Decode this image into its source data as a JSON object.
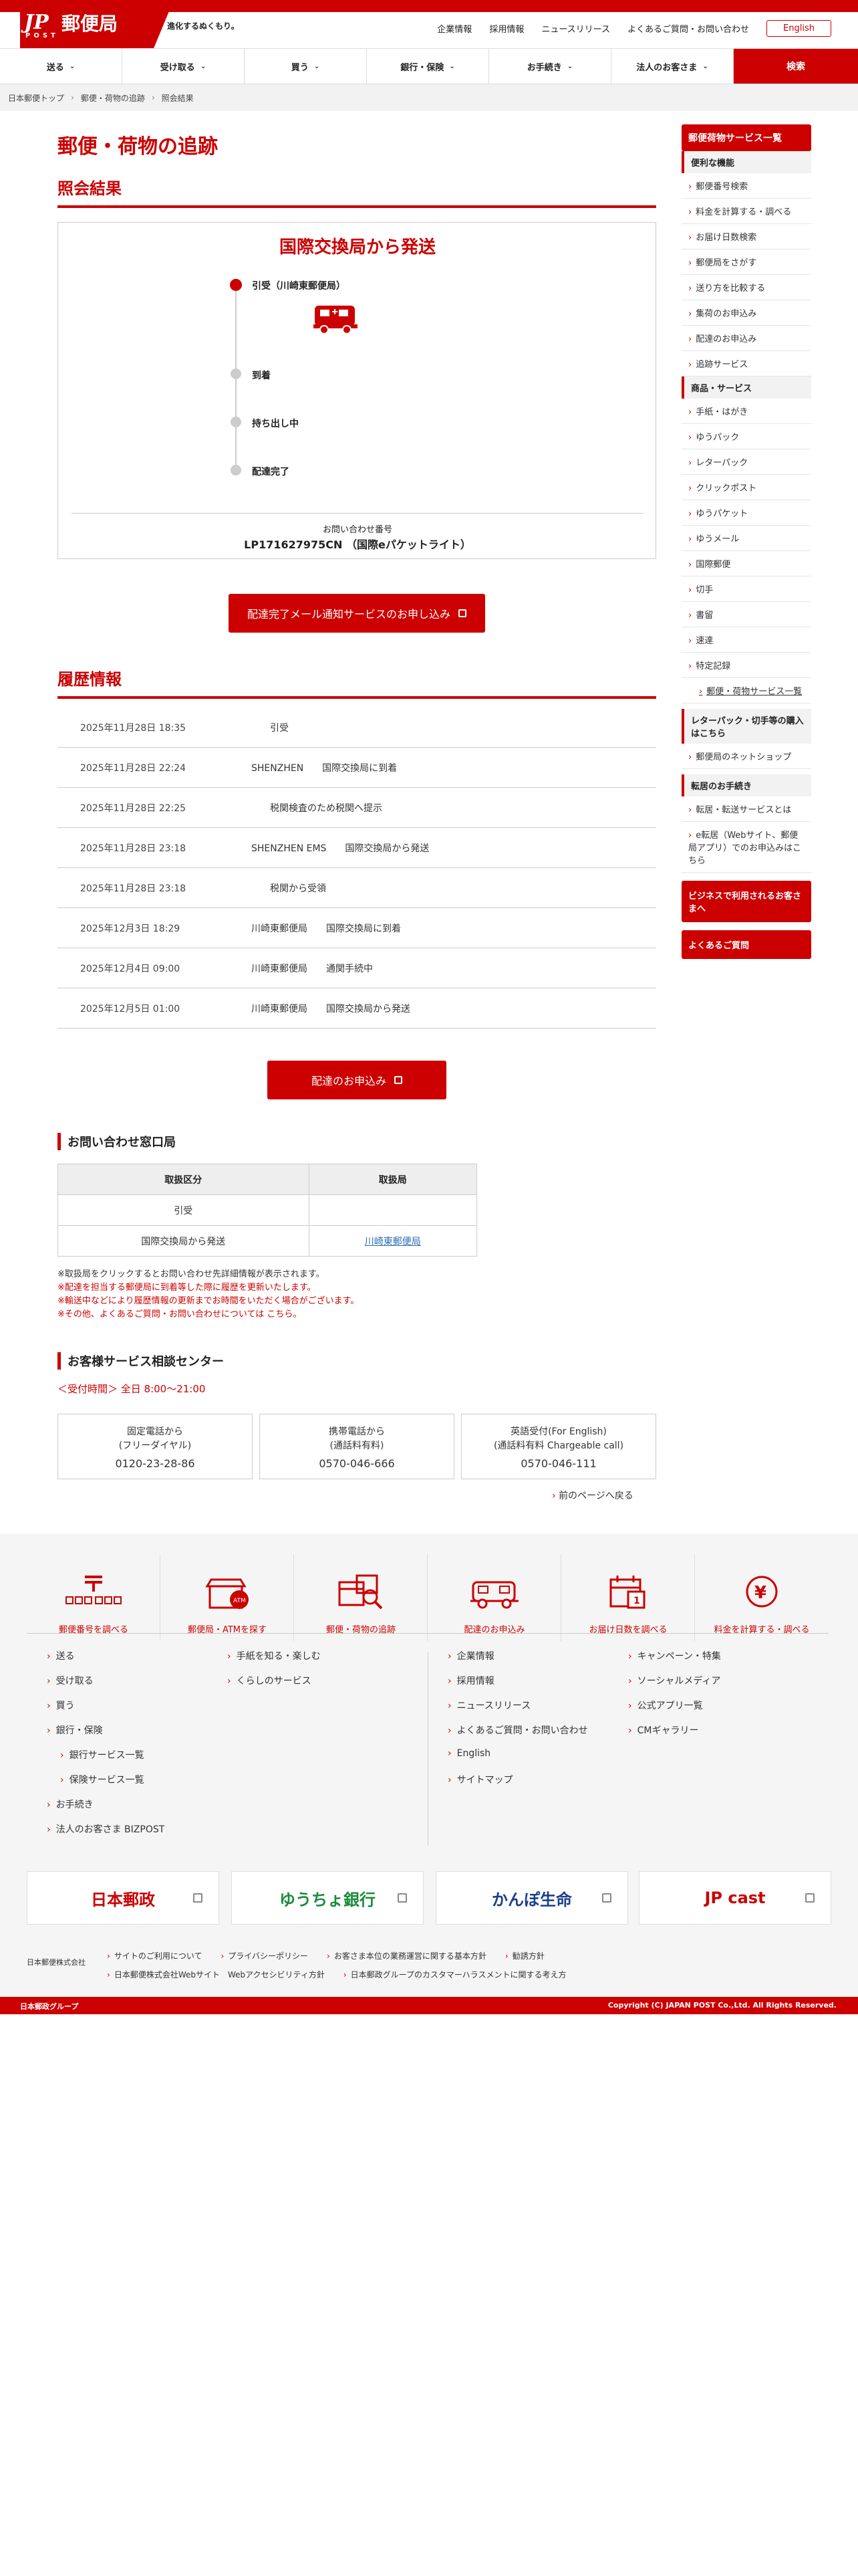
{
  "brand": {
    "logo_text": "JP",
    "logo_sub": "POST",
    "name": "郵便局",
    "tagline": "進化するぬくもり。",
    "accent": "#cc0000"
  },
  "util": [
    "企業情報",
    "採用情報",
    "ニュースリリース",
    "よくあるご質問・お問い合わせ"
  ],
  "util_english": "English",
  "nav": [
    "送る",
    "受け取る",
    "買う",
    "銀行・保険",
    "お手続き",
    "法人のお客さま"
  ],
  "nav_search": "検索",
  "breadcrumb": [
    "日本郵便トップ",
    "郵便・荷物の追跡",
    "照会結果"
  ],
  "page_title": "郵便・荷物の追跡",
  "result": {
    "heading": "照会結果",
    "status": "国際交換局から発送",
    "steps": [
      "引受（川崎東郵便局）",
      "到着",
      "持ち出し中",
      "配達完了"
    ],
    "inquiry_label": "お問い合わせ番号",
    "inquiry_number": "LP171627975CN （国際eパケットライト）",
    "notify_button": "配達完了メール通知サービスのお申し込み"
  },
  "history": {
    "heading": "履歴情報",
    "rows": [
      {
        "date": "2025年11月28日 18:35",
        "text": "　　引受"
      },
      {
        "date": "2025年11月28日 22:24",
        "text": "SHENZHEN　　国際交換局に到着"
      },
      {
        "date": "2025年11月28日 22:25",
        "text": "　　税関検査のため税関へ提示"
      },
      {
        "date": "2025年11月28日 23:18",
        "text": "SHENZHEN EMS　　国際交換局から発送"
      },
      {
        "date": "2025年11月28日 23:18",
        "text": "　　税関から受領"
      },
      {
        "date": "2025年12月3日 18:29",
        "text": "川崎東郵便局　　国際交換局に到着"
      },
      {
        "date": "2025年12月4日 09:00",
        "text": "川崎東郵便局　　通関手続中"
      },
      {
        "date": "2025年12月5日 01:00",
        "text": "川崎東郵便局　　国際交換局から発送"
      }
    ],
    "delivery_button": "配達のお申込み"
  },
  "office": {
    "heading": "お問い合わせ窓口局",
    "col1": "取扱区分",
    "col2": "取扱局",
    "rows": [
      {
        "type": "引受",
        "office": ""
      },
      {
        "type": "国際交換局から発送",
        "office": "川崎東郵便局"
      }
    ],
    "notes": [
      "※取扱局をクリックするとお問い合わせ先詳細情報が表示されます。",
      "※配達を担当する郵便局に到着等した際に履歴を更新いたします。",
      "※輸送中などにより履歴情報の更新までお時間をいただく場合がございます。",
      "※その他、よくあるご質問・お問い合わせについては こちら。"
    ]
  },
  "support": {
    "heading": "お客様サービス相談センター",
    "hours": "＜受付時間＞ 全日 8:00〜21:00",
    "phones": [
      {
        "l1": "固定電話から",
        "l2": "(フリーダイヤル)",
        "num": "0120-23-28-86"
      },
      {
        "l1": "携帯電話から",
        "l2": "(通話料有料)",
        "num": "0570-046-666"
      },
      {
        "l1": "英語受付(For English)",
        "l2": "(通話料有料 Chargeable call)",
        "num": "0570-046-111"
      }
    ],
    "back": "前のページへ戻る"
  },
  "sidebar": {
    "title": "郵便荷物サービス一覧",
    "group1": "便利な機能",
    "items1": [
      "郵便番号検索",
      "料金を計算する・調べる",
      "お届け日数検索",
      "郵便局をさがす",
      "送り方を比較する",
      "集荷のお申込み",
      "配達のお申込み",
      "追跡サービス"
    ],
    "group2": "商品・サービス",
    "items2": [
      "手紙・はがき",
      "ゆうパック",
      "レターパック",
      "クリックポスト",
      "ゆうパケット",
      "ゆうメール",
      "国際郵便",
      "切手",
      "書留",
      "速達",
      "特定記録"
    ],
    "all_link": "郵便・荷物サービス一覧",
    "group3": "レターパック・切手等の購入はこちら",
    "items3": [
      "郵便局のネットショップ"
    ],
    "group4": "転居のお手続き",
    "items4": [
      "転居・転送サービスとは",
      "e転居（Webサイト、郵便局アプリ）でのお申込みはこちら"
    ],
    "red1": "ビジネスで利用されるお客さまへ",
    "red2": "よくあるご質問"
  },
  "footer_icons": [
    "郵便番号を調べる",
    "郵便局・ATMを探す",
    "郵便・荷物の追跡",
    "配達のお申込み",
    "お届け日数を調べる",
    "料金を計算する・調べる"
  ],
  "footer_icon_names": [
    "postal-code-icon",
    "atm-icon",
    "tracking-icon",
    "delivery-truck-icon",
    "calendar-icon",
    "yen-icon"
  ],
  "footer_col1": [
    "送る",
    "受け取る",
    "買う",
    "銀行・保険",
    "銀行サービス一覧",
    "保険サービス一覧",
    "お手続き",
    "法人のお客さま BIZPOST"
  ],
  "footer_col2": [
    "手紙を知る・楽しむ",
    "くらしのサービス"
  ],
  "footer_col3": [
    "企業情報",
    "採用情報",
    "ニュースリリース",
    "よくあるご質問・お問い合わせ",
    "English",
    "サイトマップ"
  ],
  "footer_col4": [
    "キャンペーン・特集",
    "ソーシャルメディア",
    "公式アプリ一覧",
    "CMギャラリー"
  ],
  "group_logos": [
    "日本郵政",
    "ゆうちょ銀行",
    "かんぽ生命",
    "JP cast"
  ],
  "corp_name": "日本郵便株式会社",
  "legal1": [
    "サイトのご利用について",
    "プライバシーポリシー",
    "お客さま本位の業務運営に関する基本方針",
    "勧誘方針"
  ],
  "legal2": [
    "日本郵便株式会社Webサイト　Webアクセシビリティ方針",
    "日本郵政グループのカスタマーハラスメントに関する考え方"
  ],
  "group_label": "日本郵政グループ",
  "copyright": "Copyright (C) JAPAN POST Co.,Ltd. All Rights Reserved."
}
